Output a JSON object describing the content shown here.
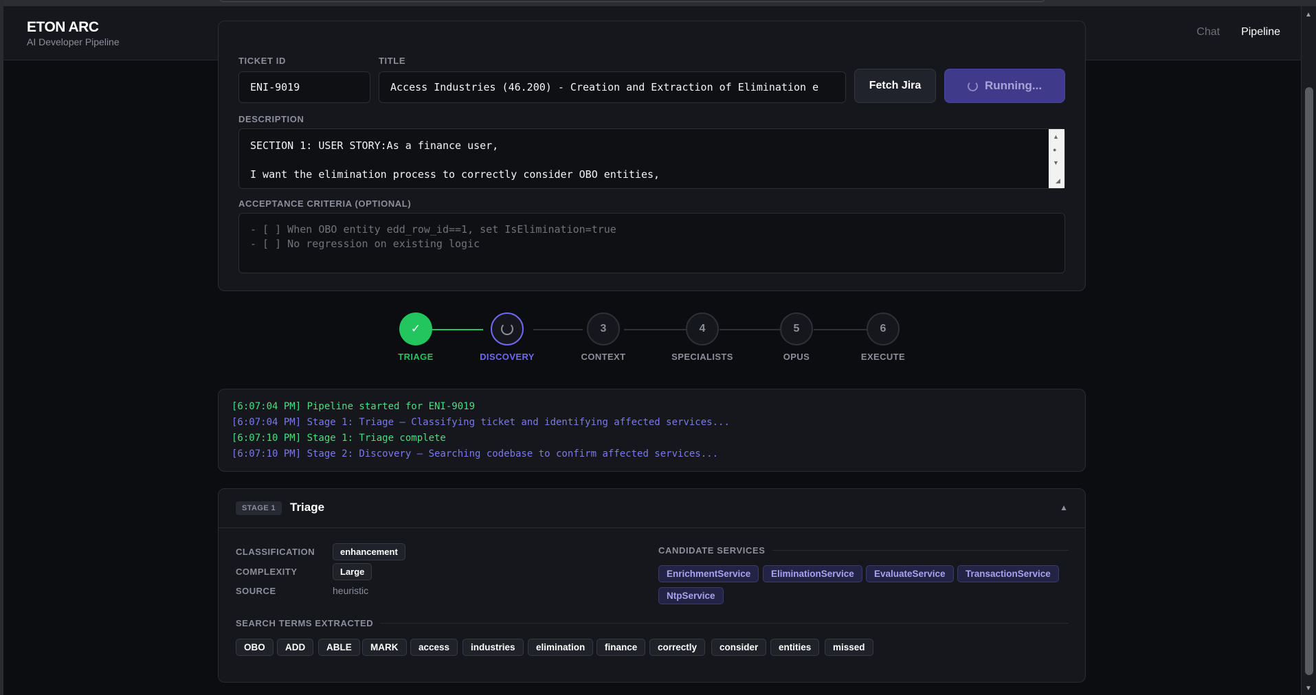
{
  "header": {
    "brand_title": "ETON ARC",
    "brand_subtitle": "AI Developer Pipeline",
    "nav": {
      "chat": "Chat",
      "pipeline": "Pipeline"
    }
  },
  "form": {
    "ticket_id_label": "TICKET ID",
    "ticket_id_value": "ENI-9019",
    "title_label": "TITLE",
    "title_value": "Access Industries (46.200) - Creation and Extraction of Elimination e",
    "fetch_button": "Fetch Jira",
    "run_button": "Running...",
    "description_label": "DESCRIPTION",
    "description_line1": "SECTION 1: USER STORY:As a finance user,",
    "description_line2": "I want the elimination process to correctly consider OBO entities,",
    "acceptance_label": "ACCEPTANCE CRITERIA (OPTIONAL)",
    "acceptance_placeholder": "- [ ] When OBO entity edd_row_id==1, set IsElimination=true\n- [ ] No regression on existing logic"
  },
  "stepper": {
    "steps": [
      {
        "num": "✓",
        "label": "TRIAGE",
        "state": "done"
      },
      {
        "num": "",
        "label": "DISCOVERY",
        "state": "active"
      },
      {
        "num": "3",
        "label": "CONTEXT",
        "state": "pending"
      },
      {
        "num": "4",
        "label": "SPECIALISTS",
        "state": "pending"
      },
      {
        "num": "5",
        "label": "OPUS",
        "state": "pending"
      },
      {
        "num": "6",
        "label": "EXECUTE",
        "state": "pending"
      }
    ],
    "colors": {
      "done": "#22c55e",
      "active": "#7068f0",
      "pending": "#8b8f99"
    }
  },
  "log": [
    {
      "text": "[6:07:04 PM] Pipeline started for ENI-9019",
      "color": "green"
    },
    {
      "text": "[6:07:04 PM] Stage 1: Triage — Classifying ticket and identifying affected services...",
      "color": "purple"
    },
    {
      "text": "[6:07:10 PM] Stage 1: Triage complete",
      "color": "green"
    },
    {
      "text": "[6:07:10 PM] Stage 2: Discovery — Searching codebase to confirm affected services...",
      "color": "purple"
    }
  ],
  "triage": {
    "stage_badge": "STAGE 1",
    "title": "Triage",
    "collapse_icon": "▲",
    "classification_label": "CLASSIFICATION",
    "classification_value": "enhancement",
    "complexity_label": "COMPLEXITY",
    "complexity_value": "Large",
    "source_label": "SOURCE",
    "source_value": "heuristic",
    "candidate_services_label": "CANDIDATE SERVICES",
    "candidate_services": [
      "EnrichmentService",
      "EliminationService",
      "EvaluateService",
      "TransactionService",
      "NtpService"
    ],
    "search_terms_label": "SEARCH TERMS EXTRACTED",
    "search_terms": [
      "OBO",
      "ADD",
      "ABLE",
      "MARK",
      "access",
      "industries",
      "elimination",
      "finance",
      "correctly",
      "consider",
      "entities",
      "missed"
    ]
  }
}
